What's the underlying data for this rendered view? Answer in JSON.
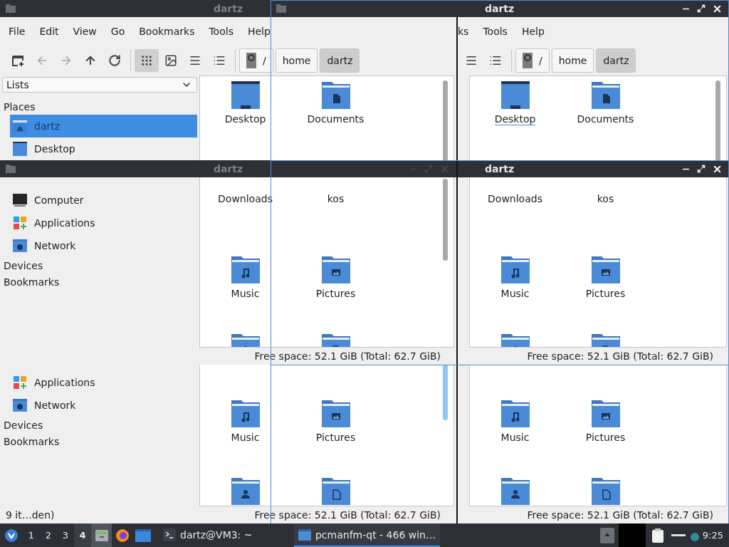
{
  "top_left": {
    "title": "dartz",
    "active": false,
    "buttons": false,
    "menu": [
      "File",
      "Edit",
      "View",
      "Go",
      "Bookmarks",
      "Tools",
      "Help"
    ],
    "nav": [
      {
        "kind": "new_tab",
        "disabled": false
      },
      {
        "kind": "back",
        "disabled": true
      },
      {
        "kind": "forward",
        "disabled": true
      },
      {
        "kind": "up",
        "disabled": false
      },
      {
        "kind": "reload",
        "disabled": false
      }
    ],
    "view_buttons": [
      {
        "kind": "icons",
        "selected": true
      },
      {
        "kind": "thumbnails",
        "selected": false
      },
      {
        "kind": "compact",
        "selected": false
      },
      {
        "kind": "details",
        "selected": false
      }
    ],
    "path": [
      {
        "label": "/",
        "kind": "root",
        "selected": false
      },
      {
        "label": "home",
        "kind": "dir",
        "selected": false
      },
      {
        "label": "dartz",
        "kind": "dir",
        "selected": true
      }
    ],
    "sidebar": {
      "dropdown": "Lists",
      "heading": "Places",
      "places": [
        {
          "label": "dartz",
          "kind": "home",
          "selected": true
        },
        {
          "label": "Desktop",
          "kind": "desktop",
          "selected": false
        }
      ]
    },
    "files": [
      {
        "label": "Desktop",
        "kind": "desktop",
        "focused": false
      },
      {
        "label": "Documents",
        "kind": "documents",
        "focused": false
      }
    ]
  },
  "top_right": {
    "title": "dartz",
    "active": true,
    "buttons": true,
    "menu": [
      "ks",
      "Tools",
      "Help"
    ],
    "view_buttons": [
      {
        "kind": "compact",
        "selected": false
      },
      {
        "kind": "details",
        "selected": false
      }
    ],
    "path": [
      {
        "label": "/",
        "kind": "root",
        "selected": false
      },
      {
        "label": "home",
        "kind": "dir",
        "selected": false
      },
      {
        "label": "dartz",
        "kind": "dir",
        "selected": true
      }
    ],
    "files": [
      {
        "label": "Desktop",
        "kind": "desktop",
        "focused": true
      },
      {
        "label": "Documents",
        "kind": "documents",
        "focused": false
      }
    ]
  },
  "middle_left": {
    "title": "dartz",
    "active": false,
    "buttons": true,
    "places": [
      {
        "label": "Computer",
        "kind": "computer",
        "selected": false
      },
      {
        "label": "Applications",
        "kind": "applications",
        "selected": false
      },
      {
        "label": "Network",
        "kind": "network",
        "selected": false
      }
    ],
    "sections": [
      "Devices",
      "Bookmarks"
    ],
    "files": [
      {
        "label": "Downloads"
      },
      {
        "label": "kos"
      },
      {
        "label": "Music",
        "kind": "music"
      },
      {
        "label": "Pictures",
        "kind": "pictures"
      },
      {
        "kind": "public"
      },
      {
        "kind": "templates"
      }
    ],
    "status": "Free space: 52.1 GiB (Total: 62.7 GiB)"
  },
  "middle_right": {
    "title": "dartz",
    "active": true,
    "buttons": true,
    "files": [
      {
        "label": "Downloads"
      },
      {
        "label": "kos"
      },
      {
        "label": "Music",
        "kind": "music"
      },
      {
        "label": "Pictures",
        "kind": "pictures"
      },
      {
        "kind": "public"
      },
      {
        "kind": "templates"
      }
    ],
    "status": "Free space: 52.1 GiB (Total: 62.7 GiB)"
  },
  "bottom_left": {
    "places": [
      {
        "label": "Applications",
        "kind": "applications",
        "selected": false
      },
      {
        "label": "Network",
        "kind": "network",
        "selected": false
      }
    ],
    "sections": [
      "Devices",
      "Bookmarks"
    ],
    "files": [
      {
        "label": "Music",
        "kind": "music"
      },
      {
        "label": "Pictures",
        "kind": "pictures"
      },
      {
        "kind": "public"
      },
      {
        "kind": "templates"
      }
    ],
    "status_left": "9 it…den)",
    "status": "Free space: 52.1 GiB (Total: 62.7 GiB)"
  },
  "bottom_right": {
    "files": [
      {
        "label": "Music",
        "kind": "music"
      },
      {
        "label": "Pictures",
        "kind": "pictures"
      },
      {
        "kind": "public"
      },
      {
        "kind": "templates"
      }
    ],
    "status": "Free space: 52.1 GiB (Total: 62.7 GiB)"
  },
  "taskbar": {
    "workspaces": [
      {
        "label": "1",
        "selected": false
      },
      {
        "label": "2",
        "selected": false
      },
      {
        "label": "3",
        "selected": false
      },
      {
        "label": "4",
        "selected": true
      }
    ],
    "launchers": [
      {
        "kind": "files",
        "selected": true
      },
      {
        "kind": "browser",
        "selected": false
      },
      {
        "kind": "window",
        "selected": false
      }
    ],
    "tasks": [
      {
        "label": "dartz@VM3: ~",
        "kind": "terminal",
        "selected": false
      },
      {
        "label": "pcmanfm-qt - 466 win…",
        "kind": "folder",
        "selected": true
      }
    ],
    "clock": "9:25"
  }
}
